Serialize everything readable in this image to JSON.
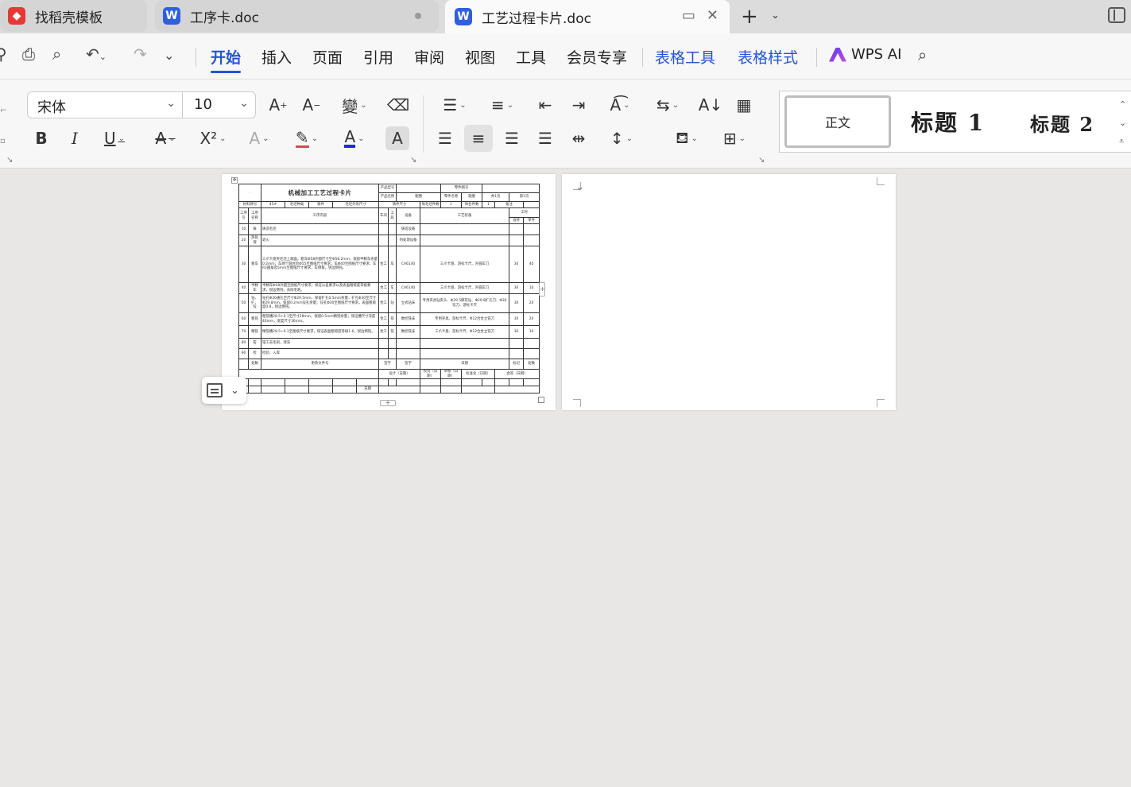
{
  "tabs": [
    {
      "label": "找稻壳模板",
      "icon": "docer-icon"
    },
    {
      "label": "工序卡.doc",
      "icon": "word-doc-icon"
    },
    {
      "label": "工艺过程卡片.doc",
      "icon": "word-doc-icon"
    }
  ],
  "icon_glyphs": {
    "word": "W",
    "docer": "◆"
  },
  "menu": {
    "items": [
      "开始",
      "插入",
      "页面",
      "引用",
      "审阅",
      "视图",
      "工具",
      "会员专享"
    ],
    "context_items": [
      "表格工具",
      "表格样式"
    ],
    "ai_label": "WPS AI",
    "active": "开始"
  },
  "ribbon": {
    "font_name": "宋体",
    "font_size": "10",
    "bold": "B",
    "italic": "I",
    "underline": "U",
    "superscript": "X²",
    "char_shading": "A",
    "styles": {
      "normal": "正文",
      "heading1": "标题 1",
      "heading2": "标题 2"
    }
  },
  "colors": {
    "accent": "#2454d8",
    "font_color_bar": "#1f2ccf",
    "highlight_bar": "#d94a4a"
  },
  "card": {
    "title": "机械加工工艺过程卡片",
    "header": {
      "product_model": "产品型号",
      "part_drawing_no": "零件图号",
      "product_name": "产品名称",
      "part_name": "零件名称",
      "part_name_value": "轭圈",
      "total": "共1页",
      "page": "第1页",
      "material_no": "材料牌号",
      "material_value": "45#",
      "blank_type": "毛坯种类",
      "blank_value": "铸件",
      "blank_size": "毛坯外形尺寸",
      "blank_size_value": "铸件尺寸",
      "blank_count": "每毛坯件数",
      "count_value": "1",
      "per_unit": "每台件数",
      "notes_col": "备注"
    },
    "columns": {
      "proc_no": "工序号",
      "proc_name": "工序名称",
      "content": "工序内容",
      "workshop": "车间",
      "section": "工段",
      "equipment": "设备",
      "tooling": "工艺装备",
      "hours": "工时",
      "prep": "准终",
      "unit": "单件"
    },
    "rows": [
      {
        "no": "10",
        "name": "铸",
        "content": "铸造毛坯",
        "ws": "",
        "sec": "",
        "equip": "铸造设备",
        "tool": "",
        "prep": "",
        "unit": ""
      },
      {
        "no": "20",
        "name": "热处理",
        "content": "退火",
        "ws": "",
        "sec": "",
        "equip": "热处理设备",
        "tool": "",
        "prep": "",
        "unit": ""
      },
      {
        "no": "30",
        "name": "粗车",
        "content": "三爪卡盘夹毛坯上端面，粗车Φ58外圆尺寸至Φ58.2mm，保留半精车余量0.2mm；车两个圆台阶Φ55至图纸尺寸要求；车Φ40至图纸尺寸要求；车R3圆角及5mm至图纸尺寸要求；车倒角，锐边倒钝。",
        "ws": "金工",
        "sec": "车",
        "equip": "CA6140",
        "tool": "三爪卡盘、游标卡尺、外圆车刀",
        "prep": "30",
        "unit": "40"
      },
      {
        "no": "40",
        "name": "半精车",
        "content": "半精车Φ58外圆至图纸尺寸要求，保证公差要求以及表面粗糙度等级要求，锐边倒钝，去除毛刺。",
        "ws": "金工",
        "sec": "车",
        "equip": "CA6140",
        "tool": "三爪卡盘、游标卡尺、外圆车刀",
        "prep": "30",
        "unit": "10"
      },
      {
        "no": "50",
        "name": "钻、扩、铰",
        "content": "钻孔Φ30通孔至尺寸Φ29.5mm，保留扩孔0.5mm余量；扩孔Φ30至尺寸Φ29.8mm，保留0.2mm铰孔余量；铰孔Φ30至图纸尺寸要求，表面粗糙度0.8，锐边倒钝。",
        "ws": "金工",
        "sec": "钻",
        "equip": "立式钻床",
        "tool": "专用夹具钻夹头、Φ29.5麻花钻、Φ29.8扩孔刀、Φ30铰刀、游标卡尺",
        "prep": "30",
        "unit": "20"
      },
      {
        "no": "60",
        "name": "粗铣",
        "content": "粗铣槽28.5+0.1至尺寸28mm，保留0.5mm精铣余量；保证槽尺寸深度40mm，宽度尺寸36mm。",
        "ws": "金工",
        "sec": "铣",
        "equip": "数控铣床",
        "tool": "专用夹具、游标卡尺、Φ12合金立铣刀",
        "prep": "30",
        "unit": "20"
      },
      {
        "no": "70",
        "name": "精铣",
        "content": "精铣槽28.5+0.1至图纸尺寸要求，保证表面粗糙度等级1.6，锐边倒钝。",
        "ws": "金工",
        "sec": "铣",
        "equip": "数控铣床",
        "tool": "三爪卡盘、游标卡尺、Φ12合金立铣刀",
        "prep": "30",
        "unit": "10"
      },
      {
        "no": "80",
        "name": "钳",
        "content": "钳工去毛刺，清洗",
        "ws": "",
        "sec": "",
        "equip": "",
        "tool": "",
        "prep": "",
        "unit": ""
      },
      {
        "no": "90",
        "name": "检",
        "content": "检验，入库",
        "ws": "",
        "sec": "",
        "equip": "",
        "tool": "",
        "prep": "",
        "unit": ""
      }
    ],
    "footer": {
      "mark": "标记",
      "qty": "处数",
      "change_doc": "更改文件号",
      "sign": "签字",
      "date": "日期",
      "design": "设计（日期）",
      "review": "校对（日期）",
      "audit": "审核（日期）",
      "standard": "标准化（日期）",
      "approve": "会签（日期）"
    }
  }
}
